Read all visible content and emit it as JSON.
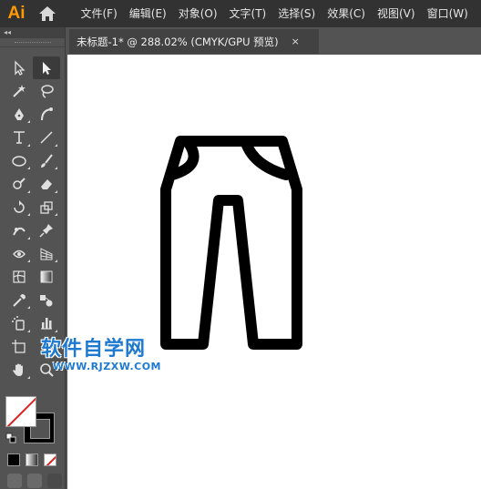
{
  "app": {
    "logo": "Ai"
  },
  "menu": [
    {
      "label": "文件(F)"
    },
    {
      "label": "编辑(E)"
    },
    {
      "label": "对象(O)"
    },
    {
      "label": "文字(T)"
    },
    {
      "label": "选择(S)"
    },
    {
      "label": "效果(C)"
    },
    {
      "label": "视图(V)"
    },
    {
      "label": "窗口(W)"
    }
  ],
  "toolpanel": {
    "collapse_label": "◂◂"
  },
  "tools": [
    [
      "direct-selection-tool",
      "selection-tool"
    ],
    [
      "magic-wand-tool",
      "lasso-tool"
    ],
    [
      "pen-tool",
      "curvature-tool"
    ],
    [
      "type-tool",
      "line-segment-tool"
    ],
    [
      "ellipse-tool",
      "paintbrush-tool"
    ],
    [
      "shaper-tool",
      "eraser-tool"
    ],
    [
      "rotate-tool",
      "scale-tool"
    ],
    [
      "puppet-warp-tool",
      "pin-tool"
    ],
    [
      "free-transform-tool",
      "perspective-grid-tool"
    ],
    [
      "mesh-tool",
      "gradient-tool"
    ],
    [
      "eyedropper-tool",
      "blend-tool"
    ],
    [
      "symbol-sprayer-tool",
      "column-graph-tool"
    ],
    [
      "artboard-tool",
      "slice-tool"
    ],
    [
      "hand-tool",
      "zoom-tool"
    ]
  ],
  "document": {
    "tab_title": "未标题-1* @ 288.02% (CMYK/GPU 预览)",
    "close": "×"
  },
  "watermark": {
    "title": "软件自学网",
    "url": "WWW.RJZXW.COM",
    "color": "#1e7ad1"
  },
  "colors": {
    "menubar": "#323232",
    "panel": "#535353",
    "logo": "#ff9a00",
    "canvas": "#ffffff"
  }
}
